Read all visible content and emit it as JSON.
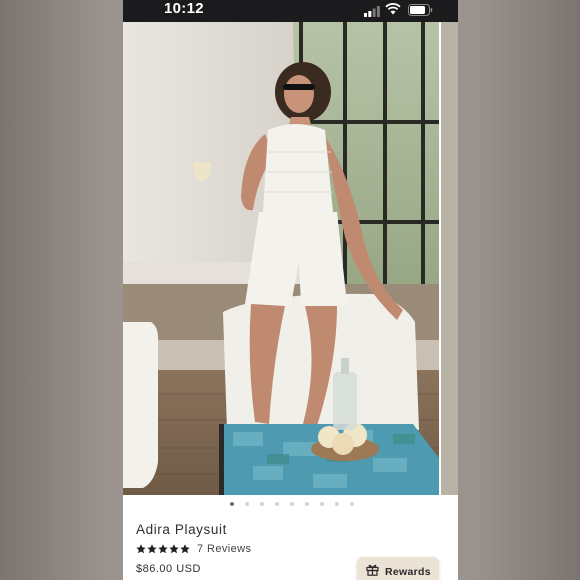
{
  "status_bar": {
    "time": "10:12"
  },
  "gallery": {
    "image_description_icon": "product-photo",
    "dots_total": 9,
    "active_index": 0
  },
  "product": {
    "name": "Adira Playsuit",
    "rating": 5,
    "reviews": "7 Reviews",
    "price": "$86.00 USD"
  },
  "rewards": {
    "label": "Rewards",
    "icon": "gift-icon"
  },
  "colors": {
    "status_bar_bg": "#1b1b1d",
    "star": "#1f1f1f",
    "rewards_bg": "#ebe3d6",
    "active_dot": "#6d6d6d",
    "inactive_dot": "#d4d4d4"
  }
}
